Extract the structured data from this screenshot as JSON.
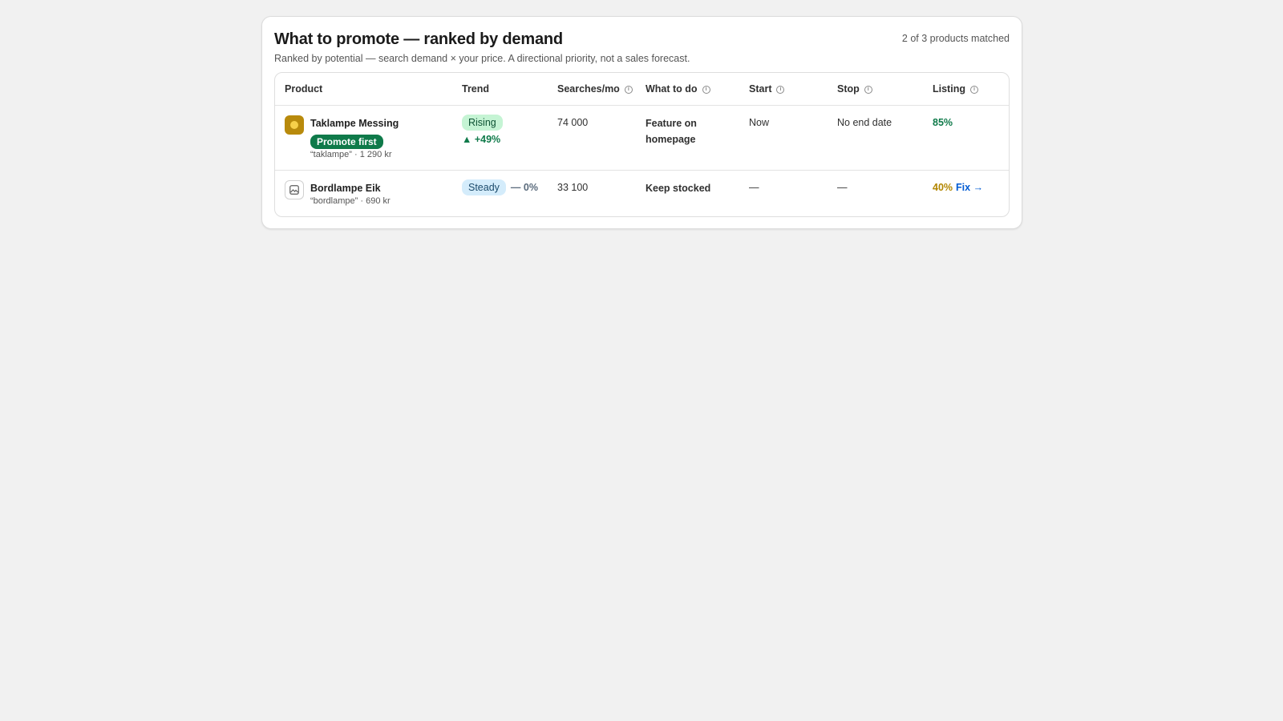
{
  "header": {
    "title": "What to promote — ranked by demand",
    "subtitle": "Ranked by potential — search demand × your price. A directional priority, not a sales forecast.",
    "count": "2 of 3 products matched"
  },
  "columns": {
    "product": "Product",
    "trend": "Trend",
    "searches": "Searches/mo",
    "action": "What to do",
    "start": "Start",
    "stop": "Stop",
    "listing": "Listing",
    "info_glyph": "i"
  },
  "rows": [
    {
      "name": "Taklampe Messing",
      "badge": "Promote first",
      "meta": "“taklampe” · 1 290 kr",
      "trend": "Rising",
      "trend_delta": "▲ +49%",
      "searches": "74 000",
      "action_line1": "Feature on",
      "action_line2": "homepage",
      "start": "Now",
      "stop": "No end date",
      "listing": "85%",
      "listing_color": "#0f7a4a"
    },
    {
      "name": "Bordlampe Eik",
      "meta": "“bordlampe” · 690 kr",
      "trend": "Steady",
      "trend_delta": "— 0%",
      "searches": "33 100",
      "action": "Keep stocked",
      "start": "—",
      "stop": "—",
      "listing": "40%",
      "listing_color": "#b28600",
      "fix_label": "Fix →"
    }
  ],
  "colors": {
    "promote_badge": "#0f7a4a",
    "rising_badge": "#c5f4d4",
    "steady_badge": "#d4ecfb",
    "link": "#005bd3"
  },
  "icons": {
    "row1_thumb": "lamp-thumbnail-icon",
    "row2_thumb": "image-placeholder-icon",
    "info": "info-icon"
  }
}
